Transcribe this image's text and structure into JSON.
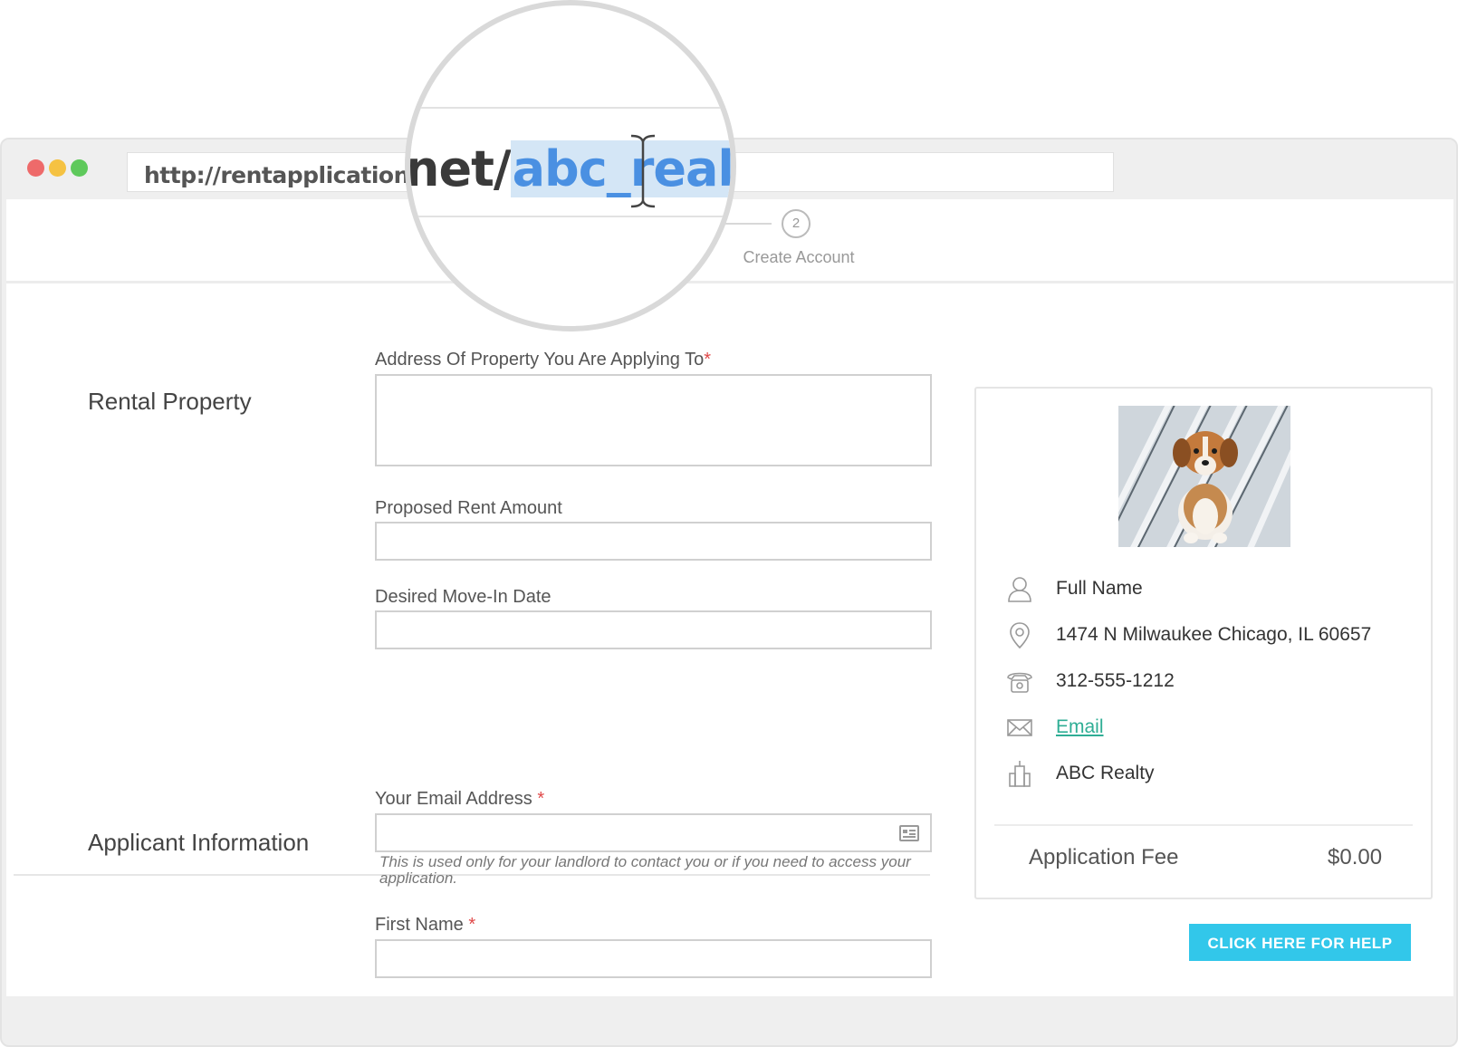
{
  "browser": {
    "url": "http://rentapplication.net/abc_realty",
    "url_prefix_shown": "http://rentapplication.n",
    "magnified_plain": "net/",
    "magnified_selected": "abc_realty",
    "dot_colors": [
      "#ee6a6a",
      "#f5c242",
      "#5ec95b"
    ]
  },
  "steps": {
    "current_number": "2",
    "current_label": "Create Account"
  },
  "sections": {
    "rental_property": "Rental Property",
    "applicant_information": "Applicant Information"
  },
  "fields": {
    "address_label": "Address Of Property You Are Applying To",
    "rent_label": "Proposed Rent Amount",
    "move_in_label": "Desired Move-In Date",
    "email_label": "Your Email Address",
    "email_hint": "This is used only for your landlord to contact you or if you need to access your application.",
    "first_name_label": "First Name",
    "required_mark": "*"
  },
  "landlord_card": {
    "name": "Full Name",
    "address": "1474 N Milwaukee Chicago, IL 60657",
    "phone": "312-555-1212",
    "email_link": "Email",
    "company": "ABC Realty",
    "fee_label": "Application Fee",
    "fee_value": "$0.00"
  },
  "help_button": "CLICK HERE FOR HELP",
  "colors": {
    "accent_teal": "#2fae95",
    "help_button": "#32c7ea",
    "required": "#e04848",
    "selection": "#d4e6f6"
  }
}
